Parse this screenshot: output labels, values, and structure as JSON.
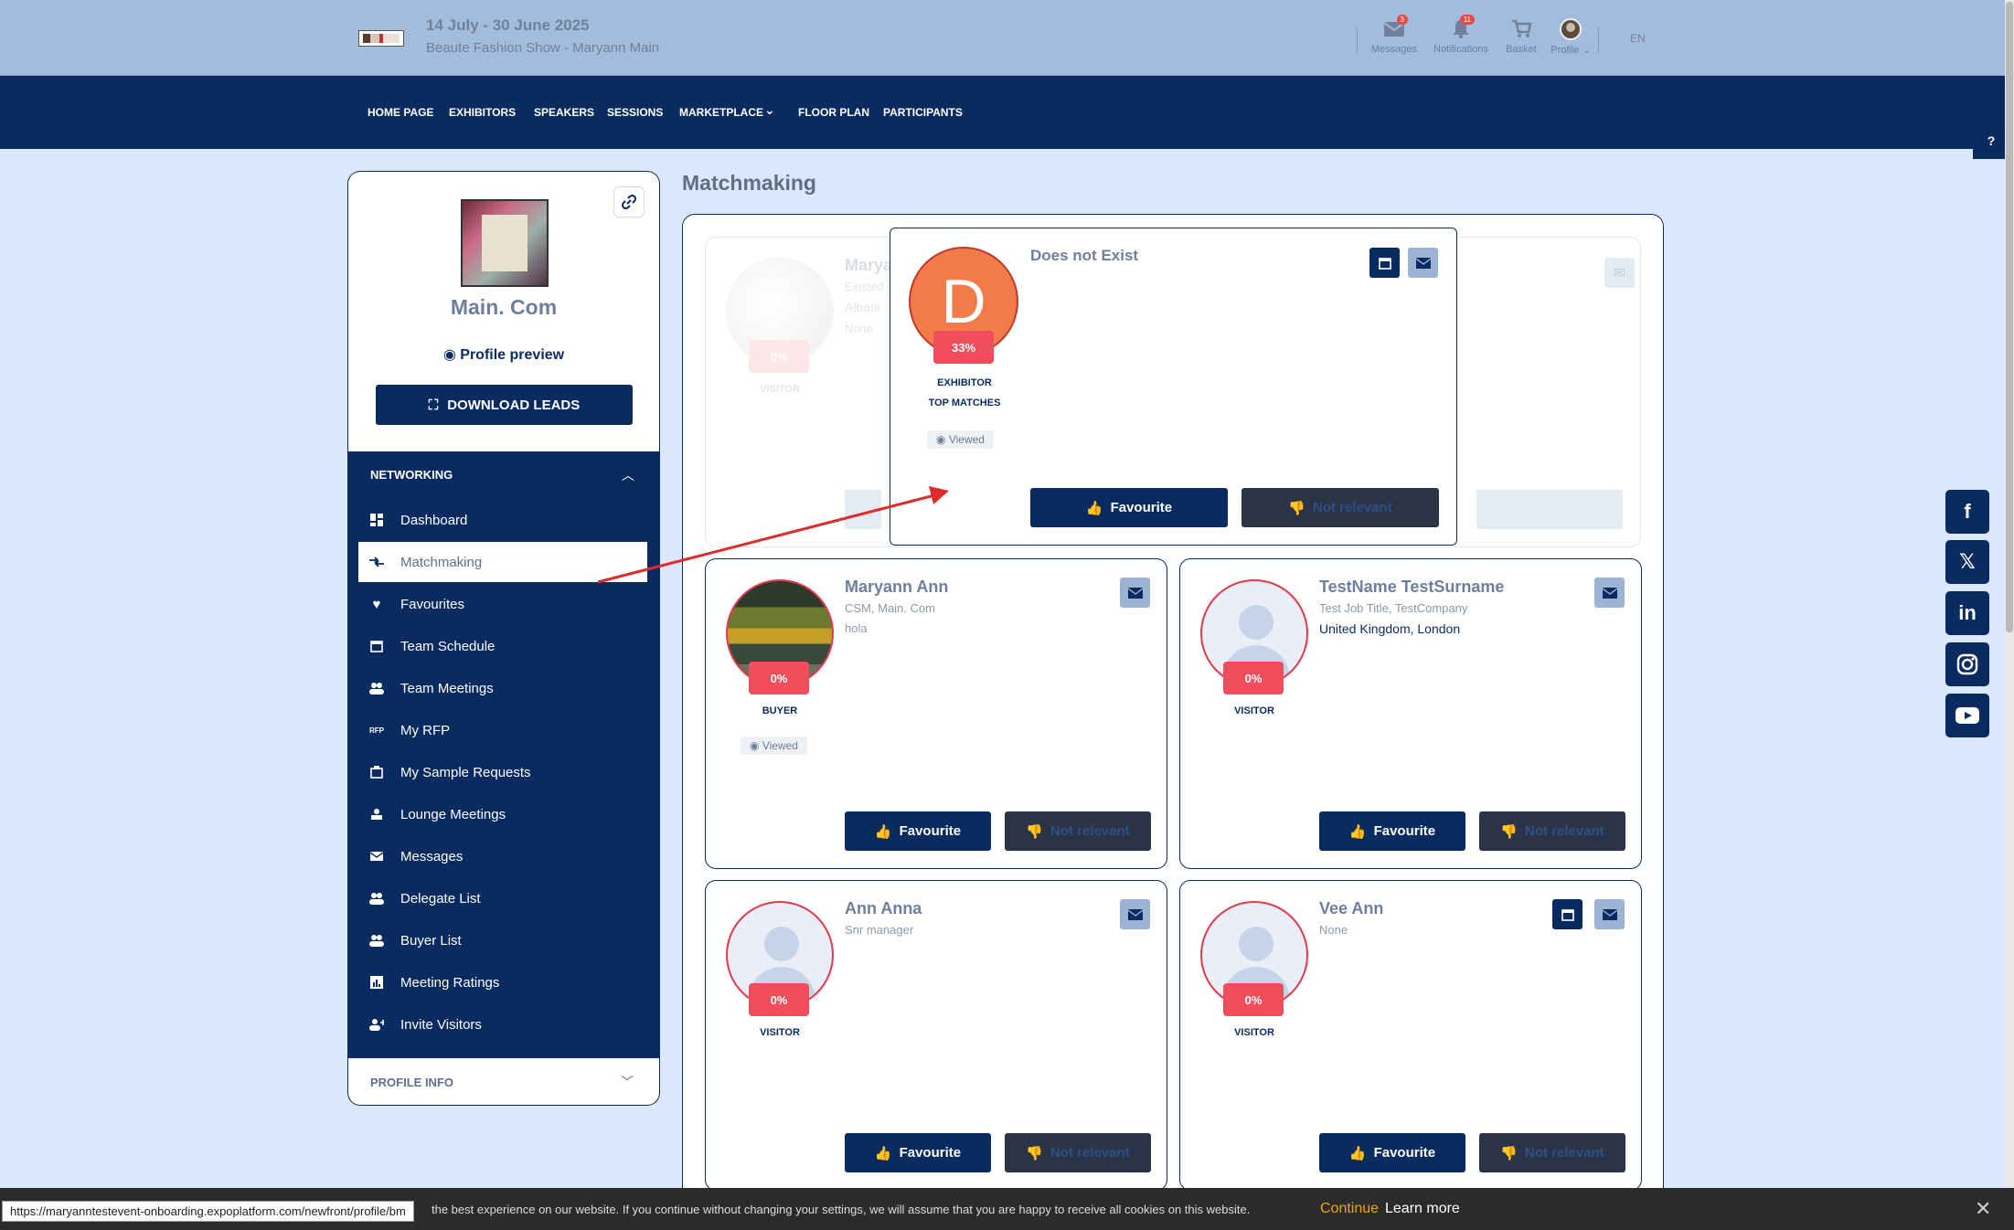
{
  "header": {
    "event_date": "14 July - 30 June 2025",
    "event_name": "Beaute Fashion Show - Maryann Main",
    "icons": [
      {
        "label": "Messages",
        "icon": "envelope-icon",
        "badge": "3"
      },
      {
        "label": "Notifications",
        "icon": "bell-icon",
        "badge": "11"
      },
      {
        "label": "Basket",
        "icon": "cart-icon",
        "badge": ""
      },
      {
        "label": "Profile",
        "icon": "avatar",
        "badge": ""
      }
    ],
    "language": "EN"
  },
  "nav": {
    "items": [
      "HOME PAGE",
      "EXHIBITORS",
      "SPEAKERS",
      "SESSIONS",
      "MARKETPLACE",
      "FLOOR PLAN",
      "PARTICIPANTS"
    ]
  },
  "sidebar": {
    "company": "Main. Com",
    "profile_preview": "Profile preview",
    "download_leads": "DOWNLOAD LEADS",
    "networking_label": "NETWORKING",
    "items": [
      {
        "label": "Dashboard",
        "icon": "dashboard-icon"
      },
      {
        "label": "Matchmaking",
        "icon": "matchmaking-icon"
      },
      {
        "label": "Favourites",
        "icon": "heart-icon"
      },
      {
        "label": "Team Schedule",
        "icon": "calendar-icon"
      },
      {
        "label": "Team Meetings",
        "icon": "team-icon"
      },
      {
        "label": "My RFP",
        "icon": "rfp-icon"
      },
      {
        "label": "My Sample Requests",
        "icon": "sample-icon"
      },
      {
        "label": "Lounge Meetings",
        "icon": "lounge-icon"
      },
      {
        "label": "Messages",
        "icon": "envelope-icon"
      },
      {
        "label": "Delegate List",
        "icon": "users-icon"
      },
      {
        "label": "Buyer List",
        "icon": "users-icon"
      },
      {
        "label": "Meeting Ratings",
        "icon": "ratings-icon"
      },
      {
        "label": "Invite Visitors",
        "icon": "invite-icon"
      }
    ],
    "profile_info_label": "PROFILE INFO"
  },
  "main": {
    "title": "Matchmaking",
    "popup": {
      "name": "Does not Exist",
      "initial": "D",
      "percent": "33%",
      "role": "EXHIBITOR",
      "tag": "TOP MATCHES",
      "viewed": "Viewed",
      "favourite": "Favourite",
      "not_relevant": "Not relevant"
    },
    "faded_card": {
      "name": "Marya",
      "line1": "Existed",
      "line2": "Albani",
      "line3": "None",
      "percent": "0%",
      "role": "VISITOR"
    },
    "cards": [
      {
        "name": "Maryann Ann",
        "title": "CSM, Main. Com",
        "location": "hola",
        "percent": "0%",
        "role": "BUYER",
        "viewed": "Viewed",
        "favourite": "Favourite",
        "not_relevant": "Not relevant"
      },
      {
        "name": "TestName TestSurname",
        "title": "Test Job Title, TestCompany",
        "location": "United Kingdom, London",
        "percent": "0%",
        "role": "VISITOR",
        "favourite": "Favourite",
        "not_relevant": "Not relevant"
      },
      {
        "name": "Ann Anna",
        "title": "Snr manager",
        "location": "",
        "percent": "0%",
        "role": "VISITOR",
        "favourite": "Favourite",
        "not_relevant": "Not relevant"
      },
      {
        "name": "Vee Ann",
        "title": "None",
        "location": "",
        "percent": "0%",
        "role": "VISITOR",
        "favourite": "Favourite",
        "not_relevant": "Not relevant"
      }
    ]
  },
  "cookie": {
    "url": "https://maryanntestevent-onboarding.expoplatform.com/newfront/profile/bm",
    "message": "the best experience on our website. If you continue without changing your settings, we will assume that you are happy to receive all cookies on this website.",
    "continue": "Continue",
    "learn_more": "Learn more"
  },
  "colors": {
    "navy": "#0a2b5f",
    "header_bg": "#a3bcdc",
    "page_bg": "#dbe8fb",
    "accent_red": "#f14d5c"
  }
}
